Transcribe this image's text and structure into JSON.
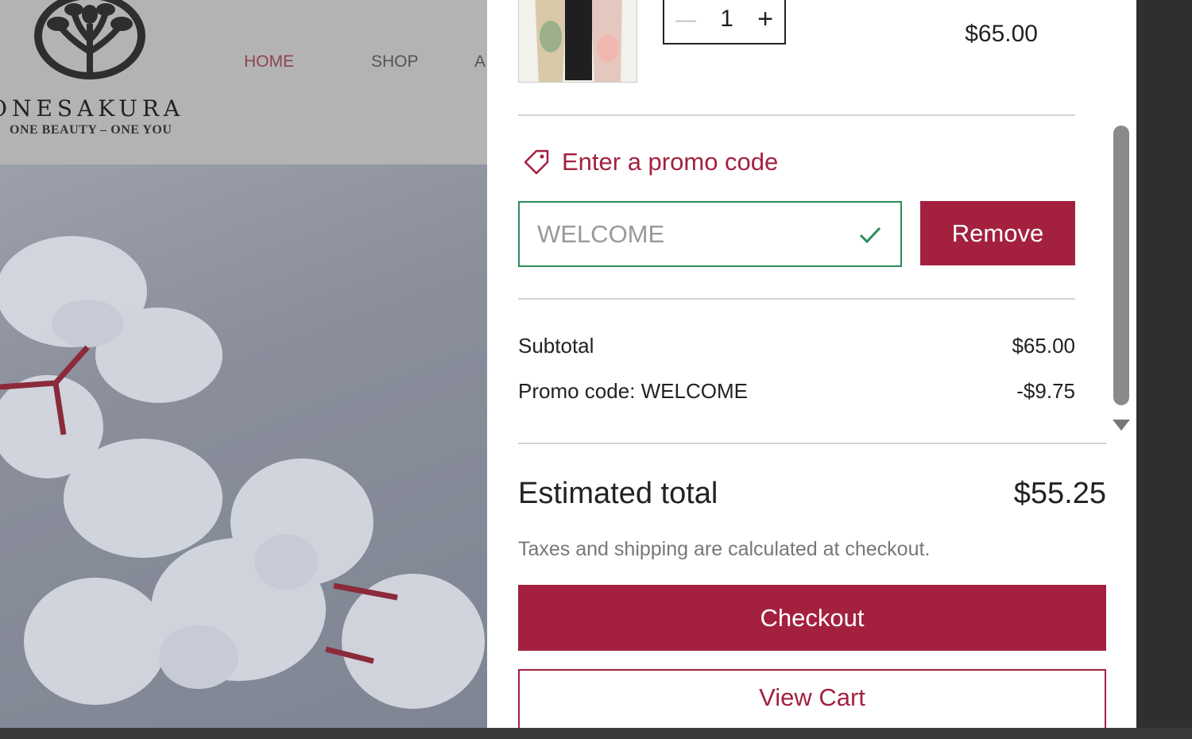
{
  "site": {
    "brand_name": "ONESAKURA",
    "brand_tagline": "ONE BEAUTY – ONE YOU",
    "nav": [
      {
        "label": "HOME"
      },
      {
        "label": "SHOP"
      },
      {
        "label": "A"
      }
    ]
  },
  "cart": {
    "item": {
      "quantity": "1",
      "minus_symbol": "—",
      "plus_symbol": "+",
      "price": "$65.00"
    },
    "promo": {
      "toggle_label": "Enter a promo code",
      "input_value": "WELCOME",
      "remove_label": "Remove"
    },
    "summary": {
      "subtotal_label": "Subtotal",
      "subtotal_value": "$65.00",
      "promo_label": "Promo code: WELCOME",
      "promo_value": "-$9.75",
      "estimated_label": "Estimated total",
      "estimated_value": "$55.25",
      "tax_note": "Taxes and shipping are calculated at checkout."
    },
    "checkout_label": "Checkout",
    "view_cart_label": "View Cart"
  },
  "colors": {
    "accent": "#a3213f",
    "success": "#2e8b57",
    "nav_active": "#8e4350"
  },
  "icons": {
    "promo": "tag-icon",
    "applied": "check-icon",
    "logo": "tree-emblem"
  }
}
